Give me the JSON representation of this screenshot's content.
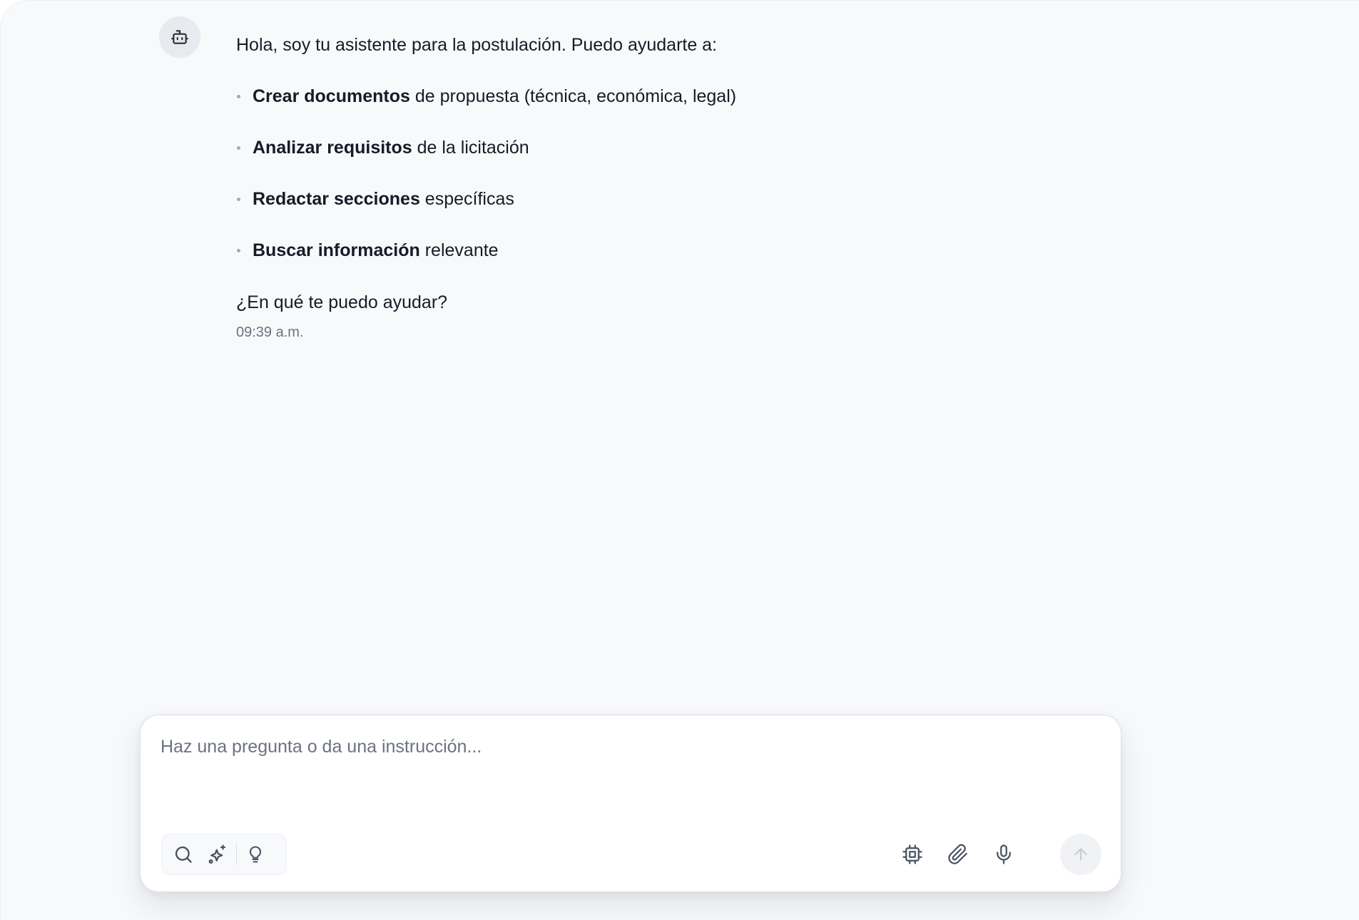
{
  "assistant": {
    "avatar_icon": "bot-icon",
    "intro": "Hola, soy tu asistente para la postulación. Puedo ayudarte a:",
    "capabilities": [
      {
        "bold": "Crear documentos",
        "rest": " de propuesta (técnica, económica, legal)"
      },
      {
        "bold": "Analizar requisitos",
        "rest": " de la licitación"
      },
      {
        "bold": "Redactar secciones",
        "rest": " específicas"
      },
      {
        "bold": "Buscar información",
        "rest": " relevante"
      }
    ],
    "question": "¿En qué te puedo ayudar?",
    "timestamp": "09:39 a.m."
  },
  "composer": {
    "placeholder": "Haz una pregunta o da una instrucción...",
    "value": "",
    "left_tools": [
      "search-icon",
      "sparkles-icon",
      "lightbulb-icon"
    ],
    "right_tools": [
      "cpu-icon",
      "paperclip-icon",
      "microphone-icon"
    ],
    "send_icon": "arrow-up-icon"
  },
  "colors": {
    "background": "#f8f9fb",
    "text": "#161b26",
    "muted": "#6c7280",
    "icon": "#4a5160"
  }
}
